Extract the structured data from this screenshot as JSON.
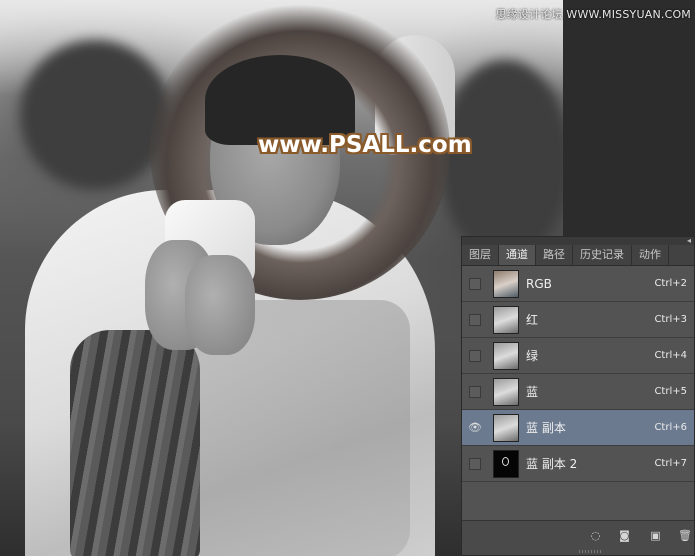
{
  "watermarks": {
    "top_right": "思缘设计论坛 WWW.MISSYUAN.COM",
    "main": "www.PSALL.com"
  },
  "channels_panel": {
    "collapse_glyph": "◂",
    "tabs": [
      {
        "label": "图层",
        "active": false
      },
      {
        "label": "通道",
        "active": true
      },
      {
        "label": "路径",
        "active": false
      },
      {
        "label": "历史记录",
        "active": false
      },
      {
        "label": "动作",
        "active": false
      }
    ],
    "channels": [
      {
        "name": "RGB",
        "shortcut": "Ctrl+2",
        "visible": false,
        "selected": false,
        "thumb": "rgb"
      },
      {
        "name": "红",
        "shortcut": "Ctrl+3",
        "visible": false,
        "selected": false,
        "thumb": "gray"
      },
      {
        "name": "绿",
        "shortcut": "Ctrl+4",
        "visible": false,
        "selected": false,
        "thumb": "gray"
      },
      {
        "name": "蓝",
        "shortcut": "Ctrl+5",
        "visible": false,
        "selected": false,
        "thumb": "gray"
      },
      {
        "name": "蓝 副本",
        "shortcut": "Ctrl+6",
        "visible": true,
        "selected": true,
        "thumb": "gray"
      },
      {
        "name": "蓝 副本 2",
        "shortcut": "Ctrl+7",
        "visible": false,
        "selected": false,
        "thumb": "dark"
      }
    ],
    "eye_glyph": "👁",
    "footer_icons": [
      "load-selection-icon",
      "save-selection-icon",
      "new-channel-icon",
      "delete-channel-icon"
    ],
    "footer_glyphs": [
      "◌",
      "◙",
      "▣",
      "🗑"
    ]
  },
  "colors": {
    "panel_bg": "#535353",
    "selected_row": "#6b7a8f",
    "watermark_outline": "#8a5a2a"
  }
}
